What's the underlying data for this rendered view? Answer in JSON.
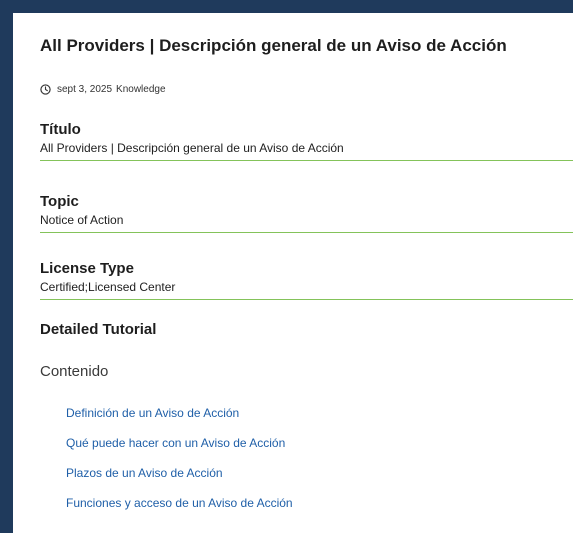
{
  "article": {
    "title": "All Providers | Descripción general de un Aviso de Acción",
    "date": "sept 3, 2025",
    "category": "Knowledge"
  },
  "fields": [
    {
      "label": "Título",
      "value": "All Providers | Descripción general de un Aviso de Acción"
    },
    {
      "label": "Topic",
      "value": "Notice of Action"
    },
    {
      "label": "License Type",
      "value": "Certified;Licensed Center"
    }
  ],
  "tutorial": {
    "heading": "Detailed Tutorial",
    "toc_title": "Contenido",
    "links": [
      "Definición de un Aviso de Acción",
      "Qué puede hacer con un Aviso de Acción",
      "Plazos de un Aviso de Acción",
      "Funciones y acceso de un Aviso de Acción"
    ]
  },
  "colors": {
    "frame": "#1f3a5c",
    "divider": "#84c35a",
    "link": "#1f5fa8"
  },
  "icons": {
    "date": "clock-icon"
  }
}
